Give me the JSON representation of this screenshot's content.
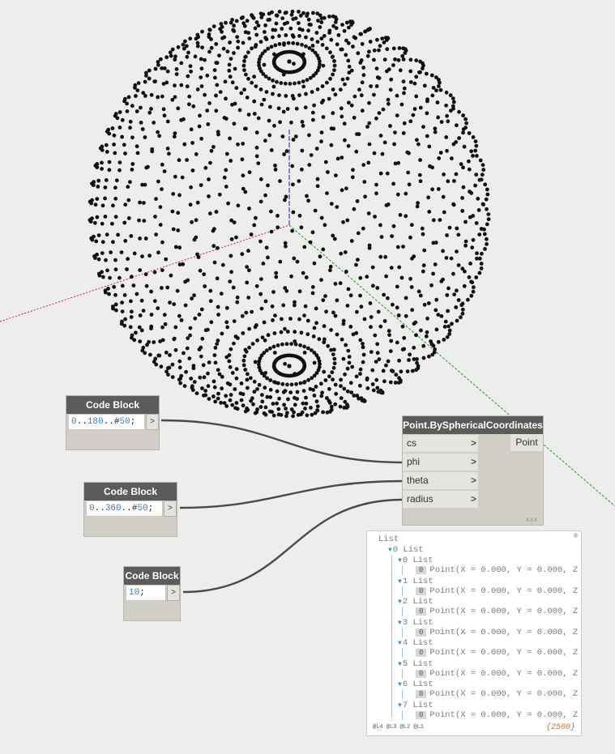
{
  "nodes": {
    "cb1": {
      "title": "Code Block",
      "code_parts": [
        "0",
        "..",
        "180",
        "..",
        "#",
        "50",
        ";"
      ],
      "output": ">"
    },
    "cb2": {
      "title": "Code Block",
      "code_parts": [
        "0",
        "..",
        "360",
        "..",
        "#",
        "50",
        ";"
      ],
      "output": ">"
    },
    "cb3": {
      "title": "Code Block",
      "code_parts": [
        "10",
        ";"
      ],
      "output": ">"
    },
    "point_node": {
      "title": "Point.BySphericalCoordinates",
      "inputs": [
        "cs",
        "phi",
        "theta",
        "radius"
      ],
      "input_arrow": ">",
      "output": "Point",
      "lacing": "xxx"
    }
  },
  "preview": {
    "root": "List",
    "level0": {
      "index": "0",
      "label": "List"
    },
    "sublists": [
      {
        "index": "0",
        "label": "List",
        "item_index": "0",
        "item": "Point(X = 0.000, Y = 0.000, Z"
      },
      {
        "index": "1",
        "label": "List",
        "item_index": "0",
        "item": "Point(X = 0.000, Y = 0.000, Z"
      },
      {
        "index": "2",
        "label": "List",
        "item_index": "0",
        "item": "Point(X = 0.000, Y = 0.000, Z"
      },
      {
        "index": "3",
        "label": "List",
        "item_index": "0",
        "item": "Point(X = 0.000, Y = 0.000, Z"
      },
      {
        "index": "4",
        "label": "List",
        "item_index": "0",
        "item": "Point(X = 0.000, Y = 0.000, Z"
      },
      {
        "index": "5",
        "label": "List",
        "item_index": "0",
        "item": "Point(X = 0.000, Y = 0.000, Z"
      },
      {
        "index": "6",
        "label": "List",
        "item_index": "0",
        "item": "Point(X = 0.000, Y = 0.000, Z"
      },
      {
        "index": "7",
        "label": "List",
        "item_index": "0",
        "item": "Point(X = 0.000, Y = 0.000, Z"
      }
    ],
    "levels": "@L4 @L3 @L2 @L1",
    "count": "{2500}"
  },
  "colors": {
    "background": "#ededed",
    "node_header": "#5b5b5b",
    "node_body": "#d1cec8",
    "wire": "#4a4a4a",
    "x_axis": "#d22020",
    "y_axis": "#1e9a1e",
    "z_axis": "#1a1aa8",
    "points": "#111111",
    "count_text": "#c76d3a"
  }
}
